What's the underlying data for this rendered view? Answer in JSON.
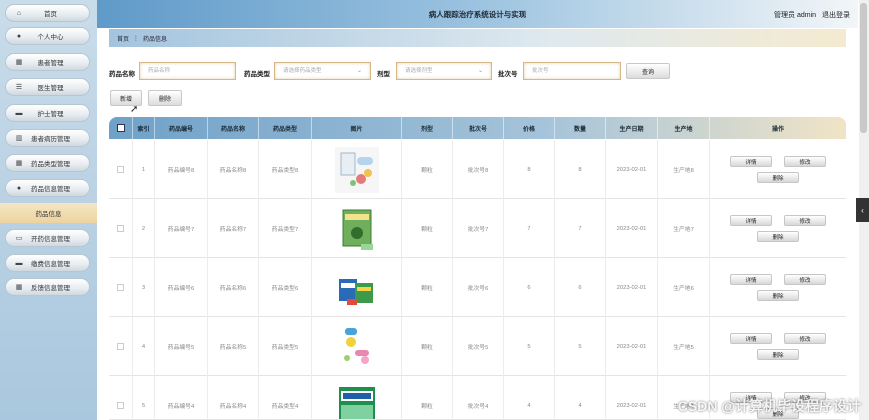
{
  "header": {
    "title": "病人跟踪治疗系统设计与实现",
    "user": "管理员 admin",
    "logout": "退出登录"
  },
  "sidebar": {
    "items": [
      {
        "label": "首页",
        "icon": "home-icon",
        "glyph": "⌂"
      },
      {
        "label": "个人中心",
        "icon": "user-icon",
        "glyph": "●"
      },
      {
        "label": "患者管理",
        "icon": "grid-icon",
        "glyph": "▦"
      },
      {
        "label": "医生管理",
        "icon": "list-icon",
        "glyph": "☰"
      },
      {
        "label": "护士管理",
        "icon": "card-icon",
        "glyph": "▬"
      },
      {
        "label": "患者病历管理",
        "icon": "book-icon",
        "glyph": "▥"
      },
      {
        "label": "药品类型管理",
        "icon": "grid-icon",
        "glyph": "▦"
      },
      {
        "label": "药品信息管理",
        "icon": "user-icon",
        "glyph": "●"
      },
      {
        "label": "药品信息",
        "icon": "",
        "glyph": ""
      },
      {
        "label": "开药信息管理",
        "icon": "pill-icon",
        "glyph": "▭"
      },
      {
        "label": "缴费信息管理",
        "icon": "card-icon",
        "glyph": "▬"
      },
      {
        "label": "反馈信息管理",
        "icon": "grid-icon",
        "glyph": "▦"
      }
    ]
  },
  "breadcrumb": {
    "home": "首页",
    "sep": "⋮",
    "current": "药品信息"
  },
  "search": {
    "name_label": "药品名称",
    "name_placeholder": "药品名称",
    "type_label": "药品类型",
    "type_placeholder": "请选择药品类型",
    "form_label": "剂型",
    "form_placeholder": "请选择剂型",
    "batch_label": "批次号",
    "batch_placeholder": "批次号",
    "query": "查询",
    "chevron": "⌄"
  },
  "actions": {
    "add": "新增",
    "delete": "删除"
  },
  "table": {
    "headers": [
      "索引",
      "药品编号",
      "药品名称",
      "药品类型",
      "图片",
      "剂型",
      "批次号",
      "价格",
      "数量",
      "生产日期",
      "生产地",
      "操作"
    ],
    "ops": {
      "detail": "详情",
      "edit": "修改",
      "delete": "删除"
    },
    "rows": [
      {
        "idx": "1",
        "code": "药品编号8",
        "name": "药品名称8",
        "type": "药品类型8",
        "form": "颗粒",
        "batch": "批次号8",
        "price": "8",
        "qty": "8",
        "date": "2023-02-01",
        "place": "生产地8"
      },
      {
        "idx": "2",
        "code": "药品编号7",
        "name": "药品名称7",
        "type": "药品类型7",
        "form": "颗粒",
        "batch": "批次号7",
        "price": "7",
        "qty": "7",
        "date": "2023-02-01",
        "place": "生产地7"
      },
      {
        "idx": "3",
        "code": "药品编号6",
        "name": "药品名称6",
        "type": "药品类型6",
        "form": "颗粒",
        "batch": "批次号6",
        "price": "6",
        "qty": "6",
        "date": "2023-02-01",
        "place": "生产地6"
      },
      {
        "idx": "4",
        "code": "药品编号5",
        "name": "药品名称5",
        "type": "药品类型5",
        "form": "颗粒",
        "batch": "批次号5",
        "price": "5",
        "qty": "5",
        "date": "2023-02-01",
        "place": "生产地5"
      },
      {
        "idx": "5",
        "code": "药品编号4",
        "name": "药品名称4",
        "type": "药品类型4",
        "form": "颗粒",
        "batch": "批次号4",
        "price": "4",
        "qty": "4",
        "date": "2023-02-01",
        "place": "生产地4"
      }
    ]
  },
  "side_tab": "‹",
  "watermark": "CSDN @计算机毕设程序设计",
  "colors": {
    "header_start": "#5f9ac9",
    "active_nav": "#ecd3a0",
    "table_header": "#6fa1c8"
  }
}
